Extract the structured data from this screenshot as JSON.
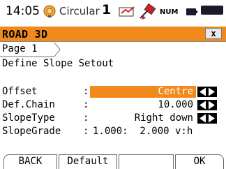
{
  "status": {
    "time": "14:05",
    "mode": "Circular",
    "face": "1",
    "num": "NUM"
  },
  "window": {
    "title": "ROAD 3D",
    "close": "x"
  },
  "tabs": [
    {
      "label": "Page 1"
    }
  ],
  "subtitle": "Define Slope Setout",
  "fields": [
    {
      "label": "Offset",
      "value": "Centre"
    },
    {
      "label": "Def.Chain",
      "value": "10.000"
    },
    {
      "label": "SlopeType",
      "value": "Right down"
    },
    {
      "label": "SlopeGrade",
      "value": "1.000:  2.000 v:h"
    }
  ],
  "softkeys": [
    "BACK",
    "Default",
    "",
    "OK"
  ],
  "colors": {
    "accent": "#f08a1c",
    "battery": "#1a1a2a"
  }
}
